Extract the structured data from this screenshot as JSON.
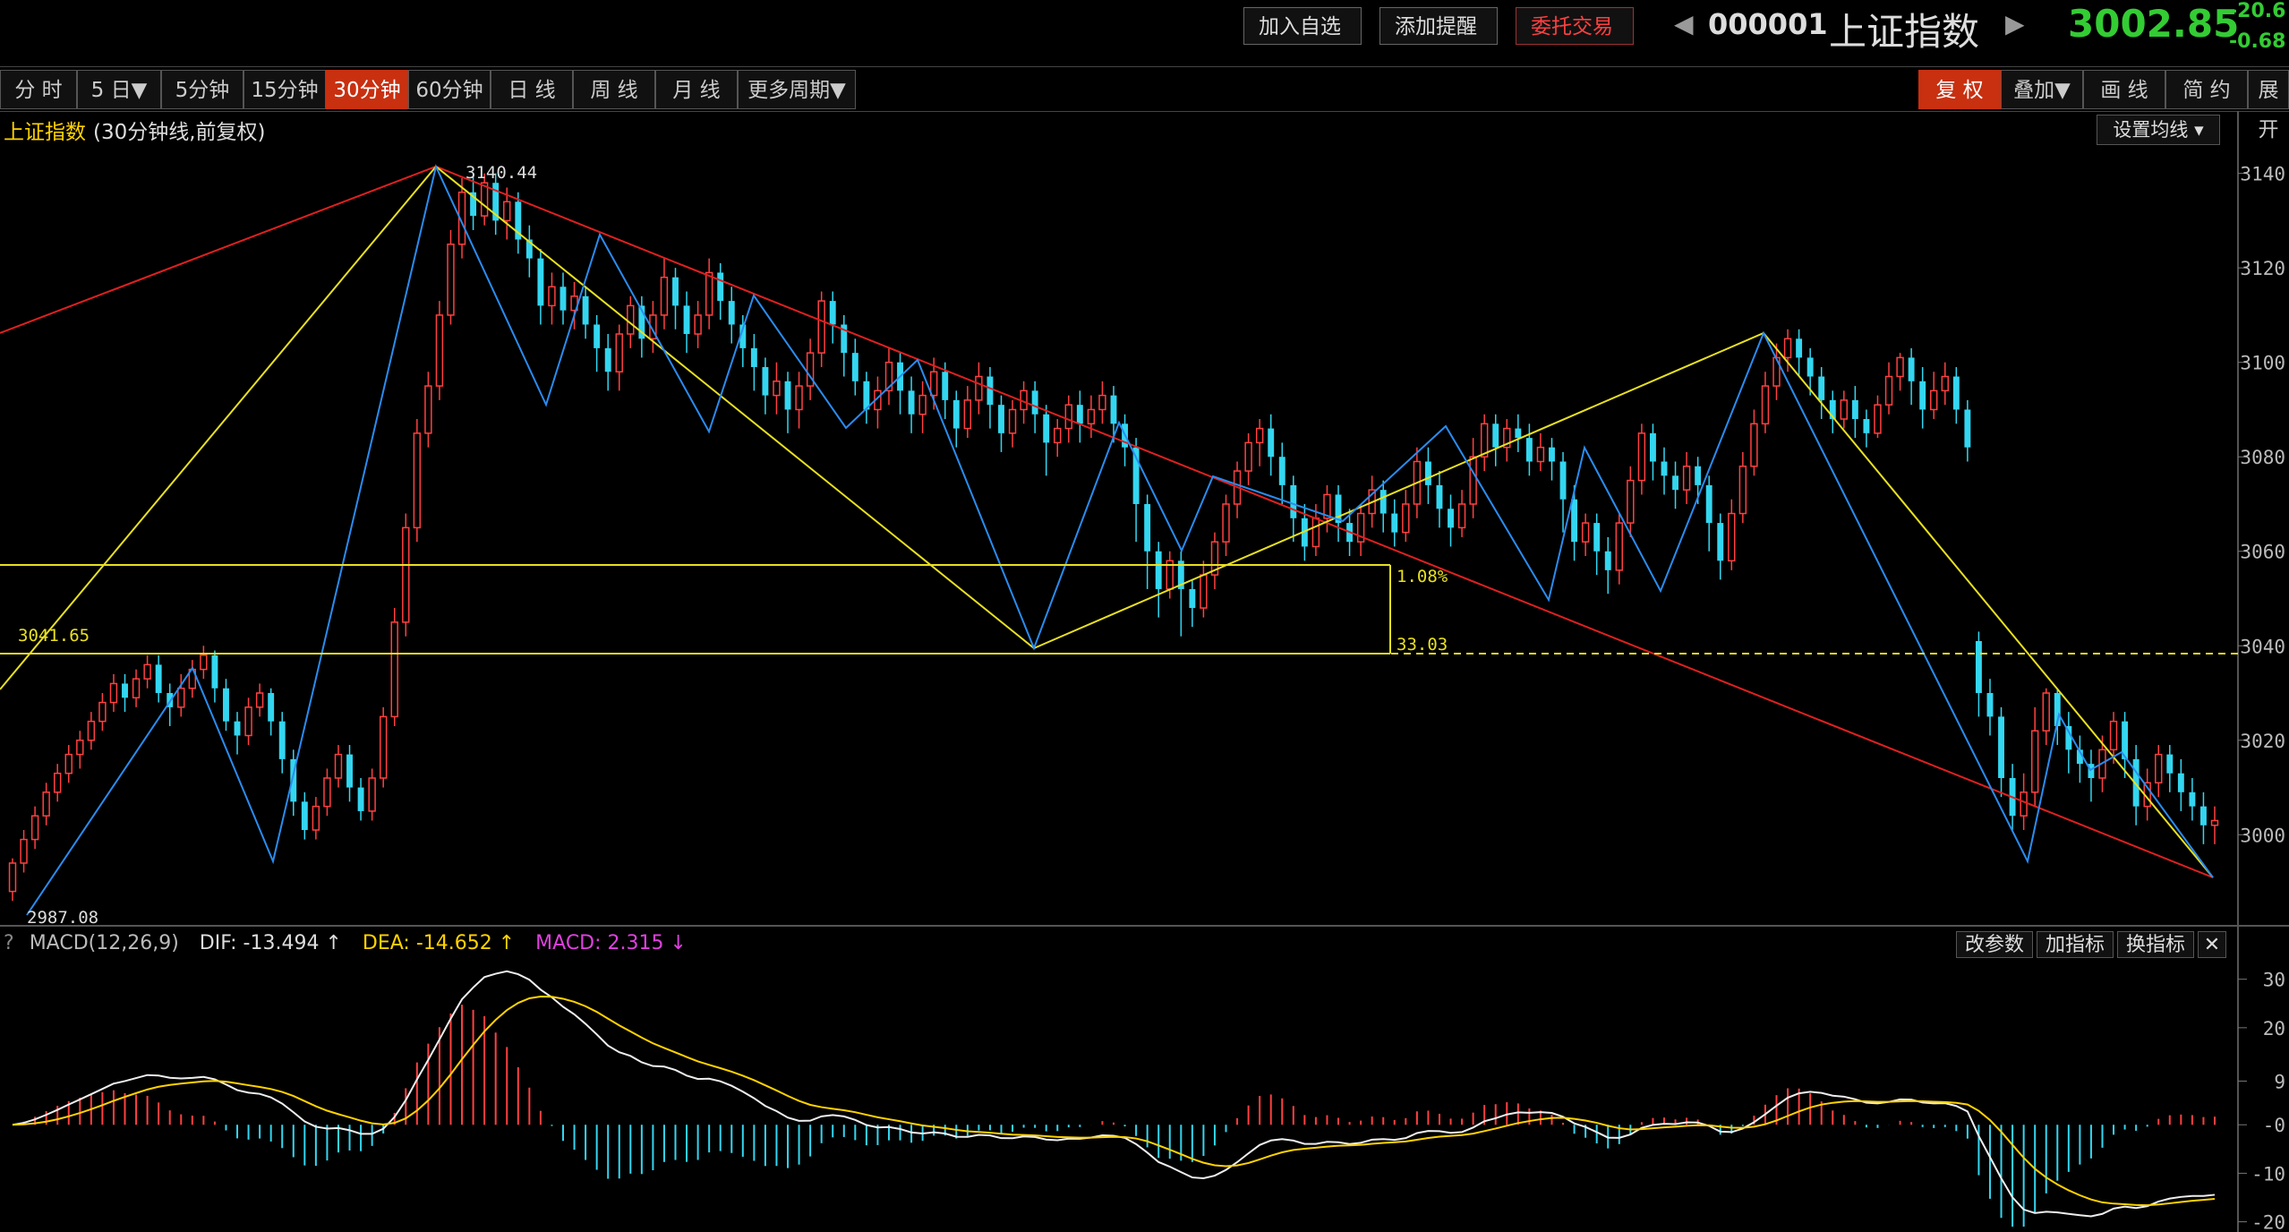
{
  "toolbar": {
    "add_watch": "加入自选",
    "add_alert": "添加提醒",
    "trade": "委托交易",
    "code": "000001",
    "name": "上证指数",
    "price": "3002.85",
    "change": "-20.6",
    "change_pct": "-0.68"
  },
  "periods": [
    "分 时",
    "5 日▼",
    "5分钟",
    "15分钟",
    "30分钟",
    "60分钟",
    "日 线",
    "周 线",
    "月 线",
    "更多周期▼"
  ],
  "active_period": "30分钟",
  "right_tools": [
    "复 权",
    "叠加▼",
    "画 线",
    "简 约",
    "展开"
  ],
  "chart_title": "上证指数",
  "chart_subtitle": "(30分钟线,前复权)",
  "set_ma": "设置均线 ▾",
  "annotations": {
    "high_label": "3140.44",
    "low_label": "2987.08",
    "level_label": "3041.65",
    "pct_label": "1.08%",
    "diff_label": "33.03"
  },
  "macd": {
    "help": "?",
    "name": "MACD(12,26,9)",
    "dif_label": "DIF: -13.494 ↑",
    "dea_label": "DEA: -14.652 ↑",
    "macd_label": "MACD: 2.315 ↓",
    "btn_params": "改参数",
    "btn_add": "加指标",
    "btn_switch": "换指标",
    "btn_close": "✕"
  },
  "colors": {
    "up": "#ff4040",
    "down": "#33d6f0",
    "accent": "#ffd200",
    "active": "#c83010"
  },
  "chart_data": {
    "type": "candlestick",
    "price_axis": {
      "ticks": [
        3000,
        3020,
        3040,
        3060,
        3080,
        3100,
        3120,
        3140
      ],
      "range": [
        2983,
        3146
      ]
    },
    "macd_axis": {
      "ticks": [
        "30",
        "20",
        "9",
        "-0",
        "-10",
        "-20"
      ],
      "range": [
        -21,
        34
      ]
    },
    "candles": [
      [
        2988,
        2994,
        2986,
        2995
      ],
      [
        2994,
        2999,
        2992,
        3001
      ],
      [
        2999,
        3004,
        2997,
        3006
      ],
      [
        3004,
        3009,
        3002,
        3011
      ],
      [
        3009,
        3013,
        3007,
        3015
      ],
      [
        3013,
        3017,
        3011,
        3019
      ],
      [
        3017,
        3020,
        3014,
        3022
      ],
      [
        3020,
        3024,
        3018,
        3026
      ],
      [
        3024,
        3028,
        3022,
        3030
      ],
      [
        3028,
        3032,
        3026,
        3034
      ],
      [
        3032,
        3029,
        3026,
        3034
      ],
      [
        3029,
        3033,
        3027,
        3035
      ],
      [
        3033,
        3036,
        3031,
        3038
      ],
      [
        3036,
        3030,
        3028,
        3038
      ],
      [
        3030,
        3027,
        3023,
        3032
      ],
      [
        3027,
        3031,
        3025,
        3034
      ],
      [
        3031,
        3035,
        3029,
        3037
      ],
      [
        3035,
        3038,
        3033,
        3040
      ],
      [
        3038,
        3031,
        3028,
        3039
      ],
      [
        3031,
        3024,
        3022,
        3033
      ],
      [
        3024,
        3021,
        3017,
        3026
      ],
      [
        3021,
        3027,
        3019,
        3029
      ],
      [
        3027,
        3030,
        3025,
        3032
      ],
      [
        3030,
        3024,
        3021,
        3031
      ],
      [
        3024,
        3016,
        3013,
        3026
      ],
      [
        3016,
        3007,
        3004,
        3018
      ],
      [
        3007,
        3001,
        2999,
        3009
      ],
      [
        3001,
        3006,
        2999,
        3008
      ],
      [
        3006,
        3012,
        3004,
        3014
      ],
      [
        3012,
        3017,
        3010,
        3019
      ],
      [
        3017,
        3010,
        3007,
        3019
      ],
      [
        3010,
        3005,
        3003,
        3012
      ],
      [
        3005,
        3012,
        3003,
        3014
      ],
      [
        3012,
        3025,
        3010,
        3027
      ],
      [
        3025,
        3045,
        3023,
        3048
      ],
      [
        3045,
        3065,
        3042,
        3068
      ],
      [
        3065,
        3085,
        3062,
        3088
      ],
      [
        3085,
        3095,
        3082,
        3098
      ],
      [
        3095,
        3110,
        3092,
        3113
      ],
      [
        3110,
        3125,
        3108,
        3128
      ],
      [
        3125,
        3136,
        3122,
        3139
      ],
      [
        3136,
        3131,
        3128,
        3140
      ],
      [
        3131,
        3138,
        3129,
        3140
      ],
      [
        3138,
        3130,
        3127,
        3140
      ],
      [
        3130,
        3134,
        3126,
        3137
      ],
      [
        3134,
        3126,
        3123,
        3136
      ],
      [
        3126,
        3122,
        3118,
        3129
      ],
      [
        3122,
        3112,
        3108,
        3124
      ],
      [
        3112,
        3116,
        3108,
        3119
      ],
      [
        3116,
        3111,
        3108,
        3119
      ],
      [
        3111,
        3114,
        3107,
        3117
      ],
      [
        3114,
        3108,
        3105,
        3116
      ],
      [
        3108,
        3103,
        3098,
        3110
      ],
      [
        3103,
        3098,
        3094,
        3106
      ],
      [
        3098,
        3106,
        3094,
        3108
      ],
      [
        3106,
        3112,
        3103,
        3114
      ],
      [
        3112,
        3105,
        3101,
        3114
      ],
      [
        3105,
        3110,
        3102,
        3113
      ],
      [
        3110,
        3118,
        3107,
        3122
      ],
      [
        3118,
        3112,
        3107,
        3120
      ],
      [
        3112,
        3106,
        3102,
        3115
      ],
      [
        3106,
        3110,
        3103,
        3113
      ],
      [
        3110,
        3119,
        3107,
        3122
      ],
      [
        3119,
        3113,
        3109,
        3121
      ],
      [
        3113,
        3108,
        3104,
        3116
      ],
      [
        3108,
        3103,
        3099,
        3110
      ],
      [
        3103,
        3099,
        3094,
        3106
      ],
      [
        3099,
        3093,
        3089,
        3101
      ],
      [
        3093,
        3096,
        3089,
        3100
      ],
      [
        3096,
        3090,
        3085,
        3098
      ],
      [
        3090,
        3095,
        3086,
        3098
      ],
      [
        3095,
        3102,
        3092,
        3105
      ],
      [
        3102,
        3113,
        3099,
        3115
      ],
      [
        3113,
        3108,
        3104,
        3115
      ],
      [
        3108,
        3102,
        3097,
        3110
      ],
      [
        3102,
        3096,
        3093,
        3105
      ],
      [
        3096,
        3090,
        3087,
        3098
      ],
      [
        3090,
        3094,
        3086,
        3097
      ],
      [
        3094,
        3100,
        3091,
        3103
      ],
      [
        3100,
        3094,
        3089,
        3102
      ],
      [
        3094,
        3089,
        3085,
        3097
      ],
      [
        3089,
        3093,
        3085,
        3096
      ],
      [
        3093,
        3098,
        3090,
        3101
      ],
      [
        3098,
        3092,
        3088,
        3100
      ],
      [
        3092,
        3086,
        3082,
        3094
      ],
      [
        3086,
        3092,
        3084,
        3095
      ],
      [
        3092,
        3097,
        3089,
        3100
      ],
      [
        3097,
        3091,
        3086,
        3099
      ],
      [
        3091,
        3085,
        3081,
        3093
      ],
      [
        3085,
        3090,
        3082,
        3092
      ],
      [
        3090,
        3094,
        3087,
        3096
      ],
      [
        3094,
        3089,
        3085,
        3096
      ],
      [
        3089,
        3083,
        3076,
        3091
      ],
      [
        3083,
        3086,
        3080,
        3088
      ],
      [
        3086,
        3091,
        3083,
        3093
      ],
      [
        3091,
        3087,
        3083,
        3094
      ],
      [
        3087,
        3090,
        3084,
        3093
      ],
      [
        3090,
        3093,
        3087,
        3096
      ],
      [
        3093,
        3087,
        3083,
        3095
      ],
      [
        3087,
        3082,
        3078,
        3089
      ],
      [
        3082,
        3070,
        3062,
        3084
      ],
      [
        3070,
        3060,
        3052,
        3072
      ],
      [
        3060,
        3052,
        3046,
        3062
      ],
      [
        3052,
        3058,
        3050,
        3060
      ],
      [
        3058,
        3052,
        3042,
        3060
      ],
      [
        3052,
        3048,
        3044,
        3054
      ],
      [
        3048,
        3055,
        3046,
        3058
      ],
      [
        3055,
        3062,
        3052,
        3064
      ],
      [
        3062,
        3070,
        3059,
        3072
      ],
      [
        3070,
        3077,
        3067,
        3079
      ],
      [
        3077,
        3083,
        3074,
        3085
      ],
      [
        3083,
        3086,
        3078,
        3088
      ],
      [
        3086,
        3080,
        3076,
        3089
      ],
      [
        3080,
        3074,
        3070,
        3083
      ],
      [
        3074,
        3067,
        3062,
        3076
      ],
      [
        3067,
        3061,
        3058,
        3070
      ],
      [
        3061,
        3067,
        3059,
        3070
      ],
      [
        3067,
        3072,
        3064,
        3074
      ],
      [
        3072,
        3066,
        3062,
        3074
      ],
      [
        3066,
        3062,
        3059,
        3069
      ],
      [
        3062,
        3068,
        3059,
        3070
      ],
      [
        3068,
        3073,
        3065,
        3076
      ],
      [
        3073,
        3068,
        3064,
        3075
      ],
      [
        3068,
        3064,
        3061,
        3071
      ],
      [
        3064,
        3070,
        3062,
        3073
      ],
      [
        3070,
        3079,
        3067,
        3082
      ],
      [
        3079,
        3074,
        3070,
        3082
      ],
      [
        3074,
        3069,
        3065,
        3077
      ],
      [
        3069,
        3065,
        3061,
        3072
      ],
      [
        3065,
        3070,
        3063,
        3073
      ],
      [
        3070,
        3080,
        3067,
        3084
      ],
      [
        3080,
        3087,
        3077,
        3089
      ],
      [
        3087,
        3082,
        3078,
        3089
      ],
      [
        3082,
        3086,
        3079,
        3088
      ],
      [
        3086,
        3084,
        3081,
        3089
      ],
      [
        3084,
        3079,
        3076,
        3087
      ],
      [
        3079,
        3082,
        3077,
        3085
      ],
      [
        3082,
        3079,
        3075,
        3084
      ],
      [
        3079,
        3071,
        3064,
        3081
      ],
      [
        3071,
        3062,
        3058,
        3074
      ],
      [
        3062,
        3066,
        3059,
        3068
      ],
      [
        3066,
        3060,
        3055,
        3068
      ],
      [
        3060,
        3056,
        3051,
        3063
      ],
      [
        3056,
        3066,
        3053,
        3068
      ],
      [
        3066,
        3075,
        3063,
        3078
      ],
      [
        3075,
        3085,
        3072,
        3087
      ],
      [
        3085,
        3079,
        3075,
        3087
      ],
      [
        3079,
        3076,
        3072,
        3082
      ],
      [
        3076,
        3073,
        3069,
        3079
      ],
      [
        3073,
        3078,
        3070,
        3081
      ],
      [
        3078,
        3074,
        3070,
        3080
      ],
      [
        3074,
        3066,
        3060,
        3076
      ],
      [
        3066,
        3058,
        3054,
        3068
      ],
      [
        3058,
        3068,
        3056,
        3071
      ],
      [
        3068,
        3078,
        3066,
        3081
      ],
      [
        3078,
        3087,
        3076,
        3090
      ],
      [
        3087,
        3095,
        3085,
        3098
      ],
      [
        3095,
        3101,
        3092,
        3104
      ],
      [
        3101,
        3105,
        3098,
        3107
      ],
      [
        3105,
        3101,
        3097,
        3107
      ],
      [
        3101,
        3097,
        3093,
        3103
      ],
      [
        3097,
        3092,
        3088,
        3099
      ],
      [
        3092,
        3088,
        3085,
        3094
      ],
      [
        3088,
        3092,
        3086,
        3094
      ],
      [
        3092,
        3088,
        3084,
        3095
      ],
      [
        3088,
        3085,
        3082,
        3090
      ],
      [
        3085,
        3091,
        3084,
        3093
      ],
      [
        3091,
        3097,
        3089,
        3100
      ],
      [
        3097,
        3101,
        3094,
        3102
      ],
      [
        3101,
        3096,
        3091,
        3103
      ],
      [
        3096,
        3090,
        3086,
        3099
      ],
      [
        3090,
        3094,
        3088,
        3098
      ],
      [
        3094,
        3097,
        3091,
        3100
      ],
      [
        3097,
        3090,
        3087,
        3099
      ],
      [
        3090,
        3082,
        3079,
        3092
      ],
      [
        3041,
        3030,
        3025,
        3043
      ],
      [
        3030,
        3025,
        3021,
        3033
      ],
      [
        3025,
        3012,
        3008,
        3027
      ],
      [
        3012,
        3004,
        3001,
        3015
      ],
      [
        3004,
        3009,
        3001,
        3013
      ],
      [
        3009,
        3022,
        3006,
        3027
      ],
      [
        3022,
        3030,
        3019,
        3031
      ],
      [
        3030,
        3023,
        3019,
        3031
      ],
      [
        3023,
        3018,
        3013,
        3026
      ],
      [
        3018,
        3015,
        3011,
        3021
      ],
      [
        3015,
        3012,
        3007,
        3018
      ],
      [
        3012,
        3018,
        3009,
        3021
      ],
      [
        3018,
        3024,
        3015,
        3026
      ],
      [
        3024,
        3016,
        3012,
        3026
      ],
      [
        3016,
        3006,
        3002,
        3019
      ],
      [
        3006,
        3011,
        3003,
        3014
      ],
      [
        3011,
        3017,
        3008,
        3019
      ],
      [
        3017,
        3013,
        3009,
        3019
      ],
      [
        3013,
        3009,
        3005,
        3016
      ],
      [
        3009,
        3006,
        3003,
        3012
      ],
      [
        3006,
        3002,
        2998,
        3009
      ],
      [
        3002,
        3003,
        2998,
        3006
      ]
    ],
    "drawing_labels": [
      "3140.44",
      "2987.08",
      "3041.65",
      "1.08%",
      "33.03"
    ]
  }
}
